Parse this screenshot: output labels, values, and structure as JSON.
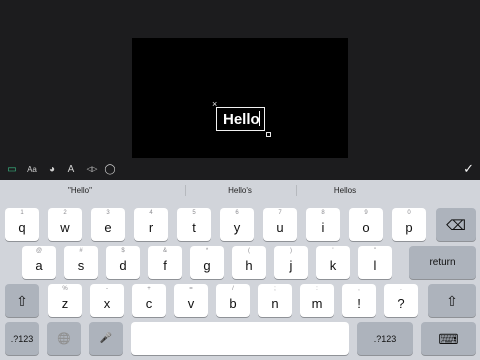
{
  "editor": {
    "text_value": "Hello",
    "delete_glyph": "×",
    "done_glyph": "✓",
    "toolbar_icons": [
      "keyboard-icon",
      "font-size-icon",
      "palette-icon",
      "text-style-icon",
      "opacity-icon",
      "shape-icon"
    ],
    "toolbar_glyphs": [
      "▭",
      "Aa",
      "◕",
      "A",
      "◁▷",
      "◯"
    ]
  },
  "keyboard": {
    "predictions": [
      "\"Hello\"",
      "Hello's",
      "Hellos"
    ],
    "row1": [
      {
        "main": "q",
        "alt": "1"
      },
      {
        "main": "w",
        "alt": "2"
      },
      {
        "main": "e",
        "alt": "3"
      },
      {
        "main": "r",
        "alt": "4"
      },
      {
        "main": "t",
        "alt": "5"
      },
      {
        "main": "y",
        "alt": "6"
      },
      {
        "main": "u",
        "alt": "7"
      },
      {
        "main": "i",
        "alt": "8"
      },
      {
        "main": "o",
        "alt": "9"
      },
      {
        "main": "p",
        "alt": "0"
      }
    ],
    "row2": [
      {
        "main": "a",
        "alt": "@"
      },
      {
        "main": "s",
        "alt": "#"
      },
      {
        "main": "d",
        "alt": "$"
      },
      {
        "main": "f",
        "alt": "&"
      },
      {
        "main": "g",
        "alt": "*"
      },
      {
        "main": "h",
        "alt": "("
      },
      {
        "main": "j",
        "alt": ")"
      },
      {
        "main": "k",
        "alt": "'"
      },
      {
        "main": "l",
        "alt": "\""
      }
    ],
    "row3": [
      {
        "main": "z",
        "alt": "%"
      },
      {
        "main": "x",
        "alt": "-"
      },
      {
        "main": "c",
        "alt": "+"
      },
      {
        "main": "v",
        "alt": "="
      },
      {
        "main": "b",
        "alt": "/"
      },
      {
        "main": "n",
        "alt": ";"
      },
      {
        "main": "m",
        "alt": ":"
      },
      {
        "main": "!",
        "alt": ","
      },
      {
        "main": "?",
        "alt": "."
      }
    ],
    "delete_glyph": "⌫",
    "return_label": "return",
    "shift_glyph": "⇧",
    "numbers_label": ".?123",
    "globe_glyph": "🌐",
    "mic_glyph": "🎤",
    "space_label": "",
    "dismiss_glyph": "⌨"
  }
}
